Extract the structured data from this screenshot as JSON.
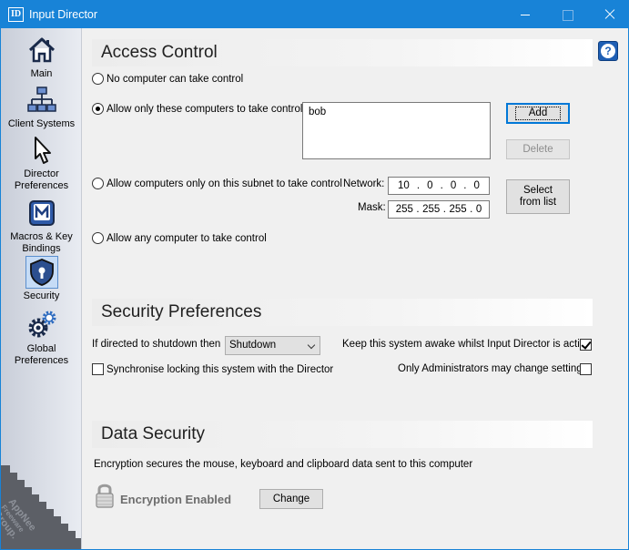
{
  "window": {
    "title": "Input Director",
    "app_icon_text": "ID"
  },
  "sidebar": {
    "items": [
      {
        "label": "Main",
        "icon": "home-icon"
      },
      {
        "label": "Client Systems",
        "icon": "network-icon"
      },
      {
        "label": "Director Preferences",
        "icon": "cursor-icon"
      },
      {
        "label": "Macros & Key Bindings",
        "icon": "macro-icon"
      },
      {
        "label": "Security",
        "icon": "shield-icon",
        "selected": true
      },
      {
        "label": "Global Preferences",
        "icon": "gears-icon"
      }
    ],
    "watermark_text": [
      "AppNee",
      "Freeware",
      "Group."
    ]
  },
  "access_control": {
    "title": "Access Control",
    "option_none": "No computer can take control",
    "option_only_these": "Allow only these computers to take control",
    "option_subnet": "Allow computers only on this subnet to take control",
    "option_any": "Allow any computer to take control",
    "selected_option": "only_these",
    "computers": [
      "bob"
    ],
    "add_label": "Add",
    "delete_label": "Delete",
    "network_label": "Network:",
    "mask_label": "Mask:",
    "network": [
      "10",
      "0",
      "0",
      "0"
    ],
    "mask": [
      "255",
      "255",
      "255",
      "0"
    ],
    "select_from_list_label": "Select from list"
  },
  "security_prefs": {
    "title": "Security Preferences",
    "shutdown_label": "If directed to shutdown then",
    "shutdown_value": "Shutdown",
    "sync_lock_label": "Synchronise locking this system with the Director",
    "sync_lock_checked": false,
    "keep_awake_label": "Keep this system awake whilst Input Director is active",
    "keep_awake_checked": true,
    "admins_only_label": "Only Administrators may change settings",
    "admins_only_checked": false
  },
  "data_security": {
    "title": "Data Security",
    "description": "Encryption secures the mouse, keyboard and clipboard data sent to this computer",
    "status": "Encryption Enabled",
    "change_label": "Change"
  },
  "colors": {
    "titlebar": "#1883d7",
    "accent": "#0078d7"
  }
}
